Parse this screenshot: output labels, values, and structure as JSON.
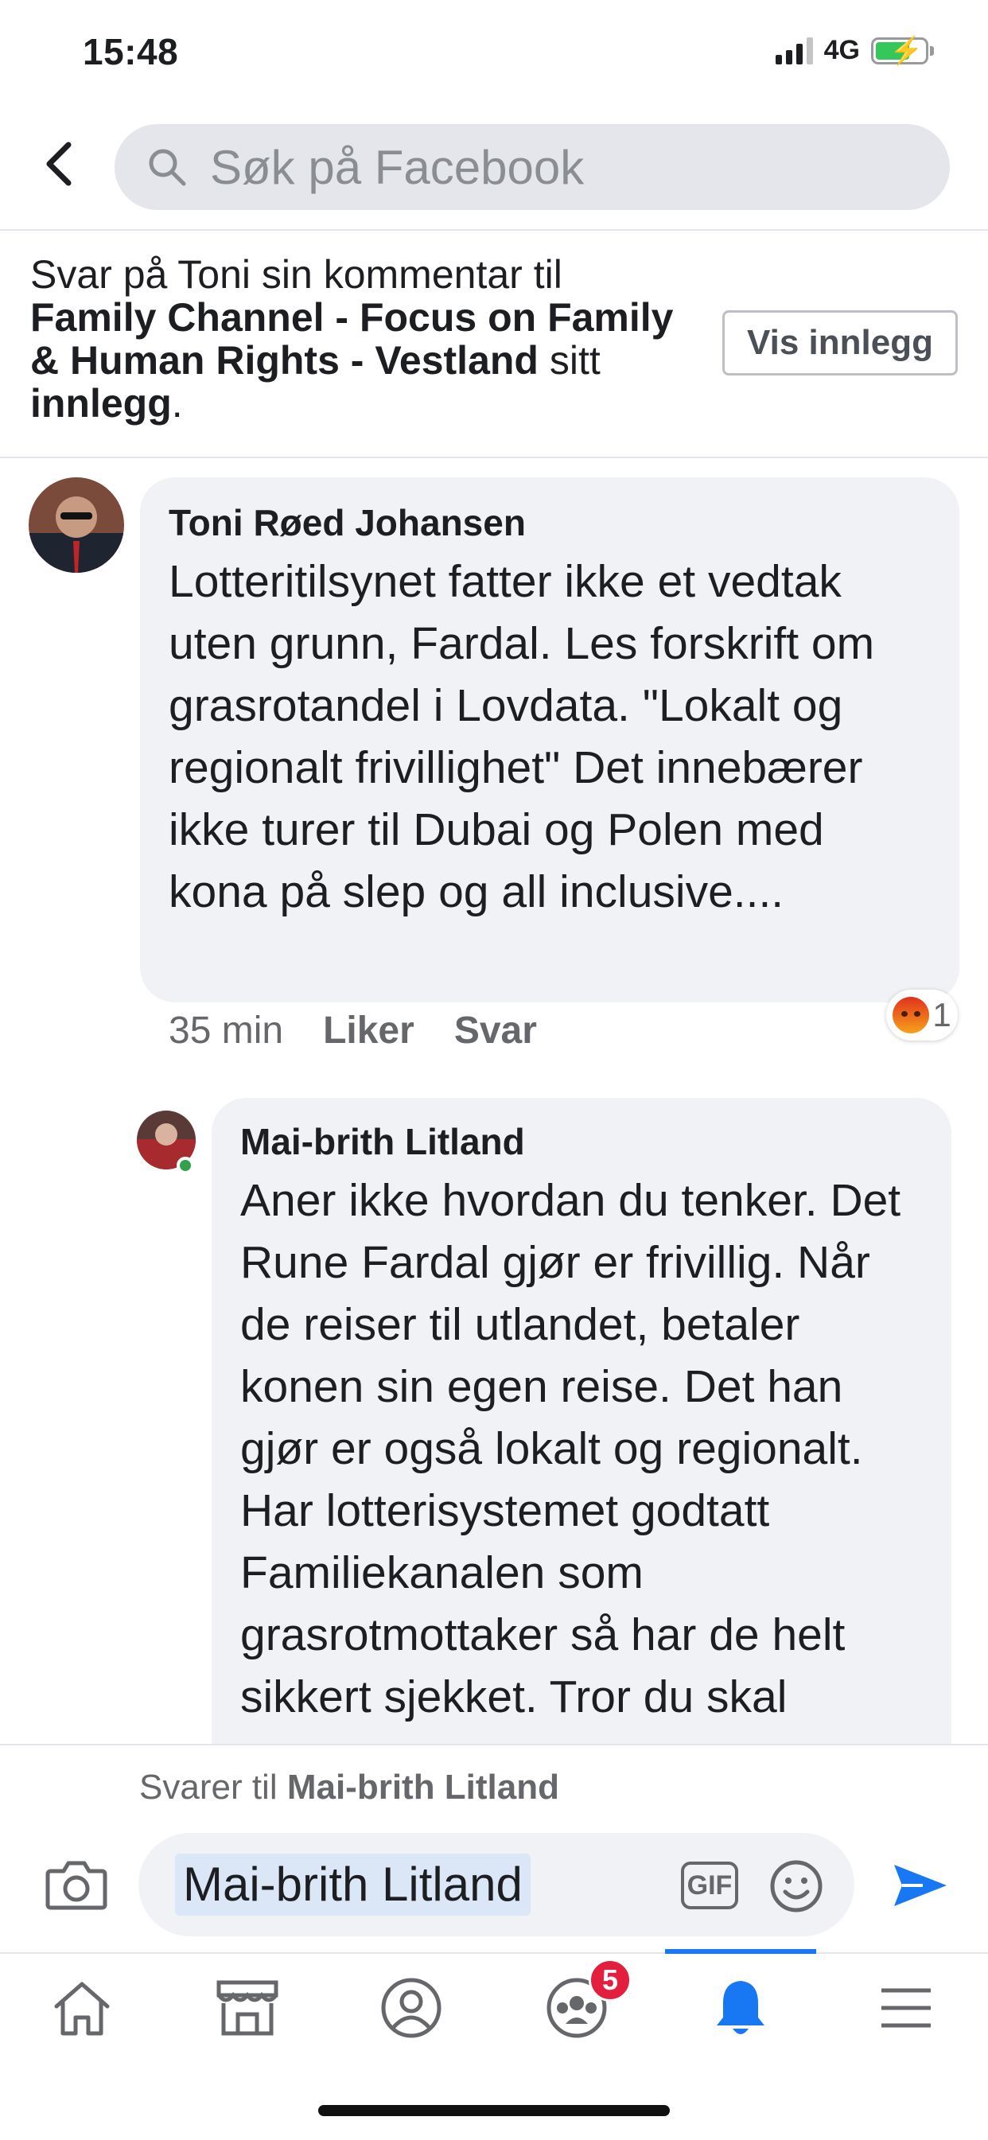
{
  "status_bar": {
    "time": "15:48",
    "network": "4G"
  },
  "header": {
    "search_placeholder": "Søk på Facebook"
  },
  "reply_context": {
    "prefix": "Svar på Toni sin kommentar til",
    "page_name": "Family Channel - Focus on Family & Human Rights - Vestland",
    "middle": "sitt",
    "post_word": "innlegg",
    "suffix": ".",
    "view_post_button": "Vis innlegg"
  },
  "comments": [
    {
      "author": "Toni Røed Johansen",
      "text": "Lotteritilsynet fatter ikke et vedtak uten grunn, Fardal. Les forskrift om grasrotandel i Lovdata. \"Lokalt og regionalt frivillighet\" Det innebærer ikke turer til Dubai og Polen med kona på slep og all inclusive....",
      "time": "35 min",
      "like": "Liker",
      "reply": "Svar",
      "reaction_count": "1"
    },
    {
      "author": "Mai-brith Litland",
      "text": "Aner ikke hvordan du tenker. Det Rune Fardal gjør er frivillig. Når de reiser til utlandet, betaler konen sin egen reise. Det han gjør er også lokalt og regionalt. Har lotterisystemet godtatt Familiekanalen som grasrotmottaker så har de helt sikkert sjekket. Tror du skal"
    }
  ],
  "composer": {
    "replying_prefix": "Svarer til",
    "replying_to": "Mai-brith Litland",
    "mention": "Mai-brith Litland",
    "gif_label": "GIF"
  },
  "bottom_nav": {
    "groups_badge": "5"
  },
  "colors": {
    "accent": "#1877f2",
    "badge": "#e41e3f",
    "bubble": "#f0f2f5"
  }
}
